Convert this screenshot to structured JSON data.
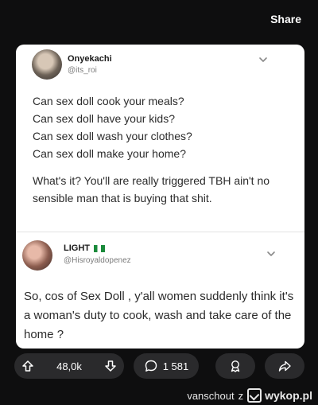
{
  "header": {
    "share_label": "Share"
  },
  "tweets": [
    {
      "name": "Onyekachi",
      "handle": "@its_roi",
      "text_lines": [
        "Can sex doll cook your meals?",
        "Can sex doll have your kids?",
        "Can sex doll wash your clothes?",
        "Can sex doll make your home?"
      ],
      "text_followup": "What's it? You'll are really triggered TBH ain't no sensible man that is buying that shit."
    },
    {
      "name": "LIGHT",
      "flag_icon": "nigeria-flag-icon",
      "handle": "@Hisroyaldopenez",
      "text": "So, cos of Sex Doll , y'all women suddenly think it's a woman's duty to cook, wash and take care of the home ?"
    }
  ],
  "actions": {
    "upvotes": "48,0k",
    "comments": "1 581",
    "icons": {
      "upvote": "arrow-up-icon",
      "downvote": "arrow-down-icon",
      "comment": "comment-bubble-icon",
      "award": "award-icon",
      "share": "share-arrow-icon"
    }
  },
  "footer": {
    "user": "vanschout",
    "separator": "z",
    "site": "wykop.pl"
  },
  "colors": {
    "background": "#0e0e0f",
    "pill": "#2a2a2c",
    "card": "#ffffff"
  }
}
